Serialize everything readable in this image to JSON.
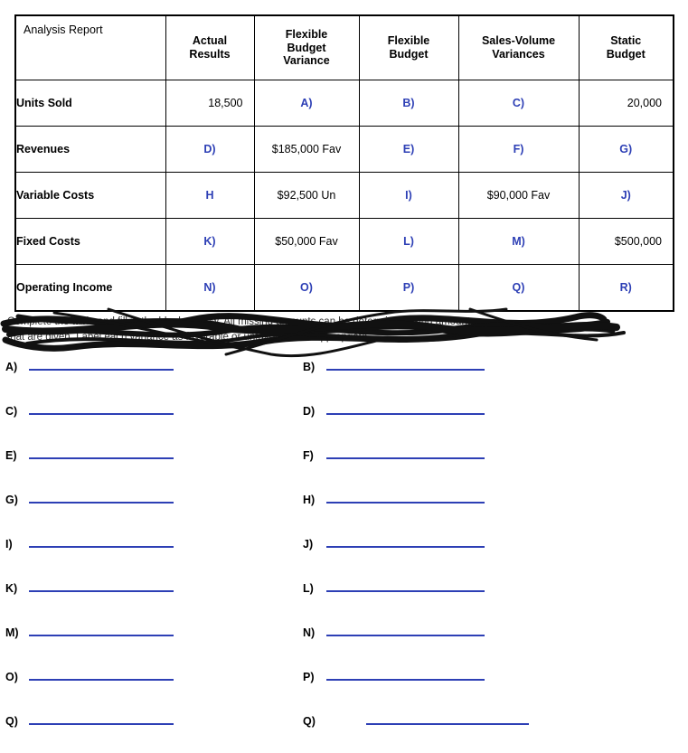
{
  "table": {
    "columns": [
      "Analysis Report",
      "Actual Results",
      "Flexible Budget Variance",
      "Flexible Budget",
      "Sales-Volume Variances",
      "Static Budget"
    ],
    "col_lines": [
      [
        "Analysis Report"
      ],
      [
        "Actual",
        "Results"
      ],
      [
        "Flexible",
        "Budget",
        "Variance"
      ],
      [
        "Flexible",
        "Budget"
      ],
      [
        "Sales-Volume",
        "Variances"
      ],
      [
        "Static",
        "Budget"
      ]
    ],
    "rows": [
      {
        "label": "Units Sold",
        "cells": [
          {
            "text": "18,500",
            "style": "num"
          },
          {
            "text": "A)",
            "style": "blue"
          },
          {
            "text": "B)",
            "style": "blue"
          },
          {
            "text": "C)",
            "style": "blue"
          },
          {
            "text": "20,000",
            "style": "num"
          }
        ]
      },
      {
        "label": "Revenues",
        "cells": [
          {
            "text": "D)",
            "style": "blue"
          },
          {
            "text": "$185,000 Fav",
            "style": "dark"
          },
          {
            "text": "E)",
            "style": "blue"
          },
          {
            "text": "F)",
            "style": "blue"
          },
          {
            "text": "G)",
            "style": "blue"
          }
        ]
      },
      {
        "label": "Variable Costs",
        "cells": [
          {
            "text": "H",
            "style": "blue"
          },
          {
            "text": "$92,500 Un",
            "style": "dark"
          },
          {
            "text": "I)",
            "style": "blue"
          },
          {
            "text": "$90,000 Fav",
            "style": "dark"
          },
          {
            "text": "J)",
            "style": "blue"
          }
        ]
      },
      {
        "label": "Fixed Costs",
        "cells": [
          {
            "text": "K)",
            "style": "blue"
          },
          {
            "text": "$50,000 Fav",
            "style": "dark"
          },
          {
            "text": "L)",
            "style": "blue"
          },
          {
            "text": "M)",
            "style": "blue"
          },
          {
            "text": "$500,000",
            "style": "num"
          }
        ]
      },
      {
        "label": "Operating Income",
        "cells": [
          {
            "text": "N)",
            "style": "blue"
          },
          {
            "text": "O)",
            "style": "blue"
          },
          {
            "text": "P)",
            "style": "blue"
          },
          {
            "text": "Q)",
            "style": "blue"
          },
          {
            "text": "R)",
            "style": "blue"
          }
        ]
      }
    ]
  },
  "instructions": {
    "line1": "Complete the table and fill in the blanks below. All missing amounts can be determined using amounts",
    "line2": "that are given. Label each variance as favorable or unfavorable as appropriate."
  },
  "answers": {
    "rows": [
      {
        "left": "A)",
        "right": "B)"
      },
      {
        "left": "C)",
        "right": "D)"
      },
      {
        "left": "E)",
        "right": "F)"
      },
      {
        "left": "G)",
        "right": "H)"
      },
      {
        "left": "I)",
        "right": "J)"
      },
      {
        "left": "K)",
        "right": "L)"
      },
      {
        "left": "M)",
        "right": "N)"
      },
      {
        "left": "O)",
        "right": "P)"
      },
      {
        "left": "Q)",
        "right": "Q)"
      }
    ]
  },
  "colors": {
    "accent_blue": "#2d3fb5",
    "border": "#000000",
    "text": "#000000"
  }
}
